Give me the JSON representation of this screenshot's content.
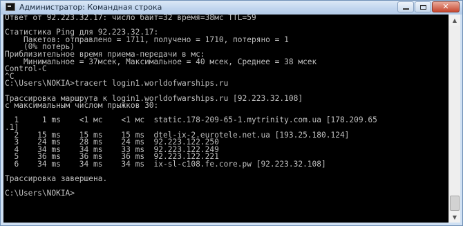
{
  "window": {
    "title": "Администратор: Командная строка",
    "controls": {
      "minimize_icon": "minimize-icon",
      "maximize_icon": "maximize-icon",
      "close_glyph": "✕"
    }
  },
  "console": {
    "lines": [
      "Ответ от 92.223.32.17: число байт=32 время=38мс TTL=59",
      "",
      "Статистика Ping для 92.223.32.17:",
      "    Пакетов: отправлено = 1711, получено = 1710, потеряно = 1",
      "    (0% потерь)",
      "Приблизительное время приема-передачи в мс:",
      "    Минимальное = 37мсек, Максимальное = 40 мсек, Среднее = 38 мсек",
      "Control-C",
      "^C",
      "C:\\Users\\NOKIA>tracert login1.worldofwarships.ru",
      "",
      "Трассировка маршрута к login1.worldofwarships.ru [92.223.32.108]",
      "с максимальным числом прыжков 30:",
      "",
      "  1     1 ms    <1 мс    <1 мс  static.178-209-65-1.mytrinity.com.ua [178.209.65",
      ".1]",
      "  2    15 ms    15 ms    15 ms  dtel-ix-2.eurotele.net.ua [193.25.180.124]",
      "  3    24 ms    28 ms    24 ms  92.223.122.250",
      "  4    34 ms    34 ms    33 ms  92.223.122.249",
      "  5    36 ms    36 ms    36 ms  92.223.122.221",
      "  6    34 ms    34 ms    34 ms  ix-sl-c108.fe.core.pw [92.223.32.108]",
      "",
      "Трассировка завершена.",
      "",
      "C:\\Users\\NOKIA>"
    ]
  },
  "scrollbar": {
    "up_glyph": "▲",
    "down_glyph": "▼"
  },
  "colors": {
    "console_background": "#000000",
    "console_text": "#c0c0c0",
    "titlebar": "#c2d6ee",
    "close_button": "#c7472f"
  }
}
